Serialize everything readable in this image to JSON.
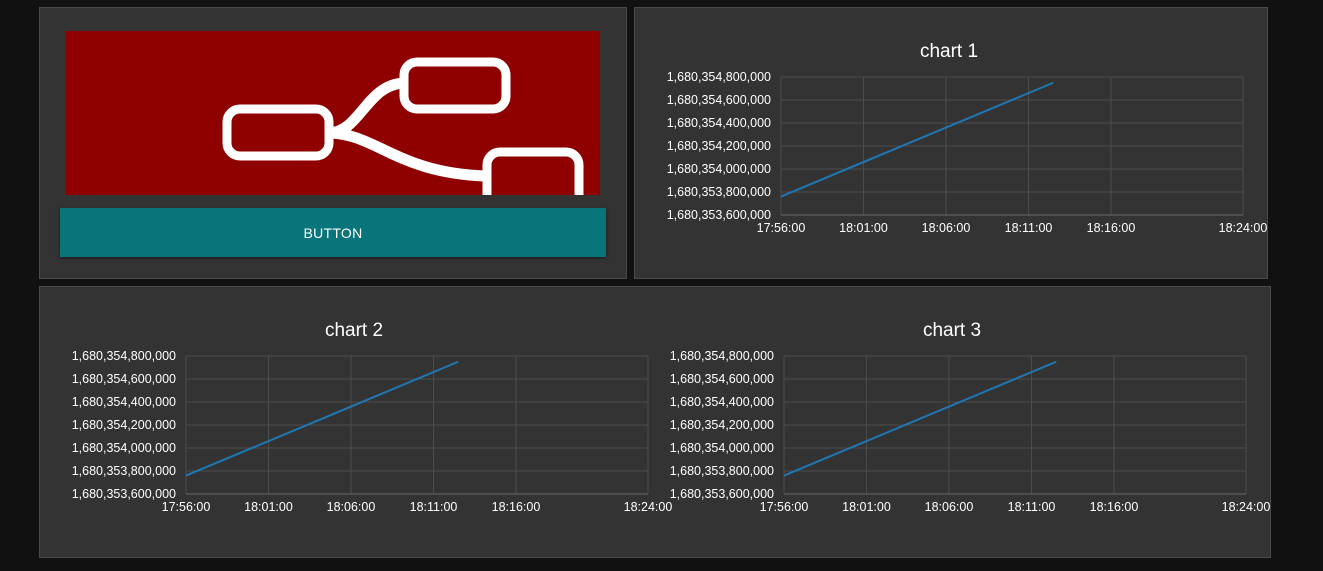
{
  "widgets": {
    "button": {
      "label": "BUTTON"
    },
    "logo": {
      "icon": "node-red-logo-icon",
      "background": "#8f0000"
    }
  },
  "colors": {
    "page_bg": "#111111",
    "card_bg": "#333333",
    "button_bg": "#097479",
    "line": "#1f77b4",
    "grid": "#4c4c4c"
  },
  "chart_data": [
    {
      "type": "line",
      "title": "chart 1",
      "xlabel": "",
      "ylabel": "",
      "x_ticks": [
        "17:56:00",
        "18:01:00",
        "18:06:00",
        "18:11:00",
        "18:16:00",
        "18:24:00"
      ],
      "y_ticks": [
        "1,680,353,600,000",
        "1,680,353,800,000",
        "1,680,354,000,000",
        "1,680,354,200,000",
        "1,680,354,400,000",
        "1,680,354,600,000",
        "1,680,354,800,000"
      ],
      "xlim": [
        "17:56:00",
        "18:24:00"
      ],
      "ylim": [
        1680353600000,
        1680354800000
      ],
      "grid": true,
      "series": [
        {
          "x": [
            "17:56:00",
            "18:12:30"
          ],
          "y": [
            1680353760000,
            1680354750000
          ]
        }
      ]
    },
    {
      "type": "line",
      "title": "chart 2",
      "xlabel": "",
      "ylabel": "",
      "x_ticks": [
        "17:56:00",
        "18:01:00",
        "18:06:00",
        "18:11:00",
        "18:16:00",
        "18:24:00"
      ],
      "y_ticks": [
        "1,680,353,600,000",
        "1,680,353,800,000",
        "1,680,354,000,000",
        "1,680,354,200,000",
        "1,680,354,400,000",
        "1,680,354,600,000",
        "1,680,354,800,000"
      ],
      "xlim": [
        "17:56:00",
        "18:24:00"
      ],
      "ylim": [
        1680353600000,
        1680354800000
      ],
      "grid": true,
      "series": [
        {
          "x": [
            "17:56:00",
            "18:12:30"
          ],
          "y": [
            1680353760000,
            1680354750000
          ]
        }
      ]
    },
    {
      "type": "line",
      "title": "chart 3",
      "xlabel": "",
      "ylabel": "",
      "x_ticks": [
        "17:56:00",
        "18:01:00",
        "18:06:00",
        "18:11:00",
        "18:16:00",
        "18:24:00"
      ],
      "y_ticks": [
        "1,680,353,600,000",
        "1,680,353,800,000",
        "1,680,354,000,000",
        "1,680,354,200,000",
        "1,680,354,400,000",
        "1,680,354,600,000",
        "1,680,354,800,000"
      ],
      "xlim": [
        "17:56:00",
        "18:24:00"
      ],
      "ylim": [
        1680353600000,
        1680354800000
      ],
      "grid": true,
      "series": [
        {
          "x": [
            "17:56:00",
            "18:12:30"
          ],
          "y": [
            1680353760000,
            1680354750000
          ]
        }
      ]
    }
  ]
}
